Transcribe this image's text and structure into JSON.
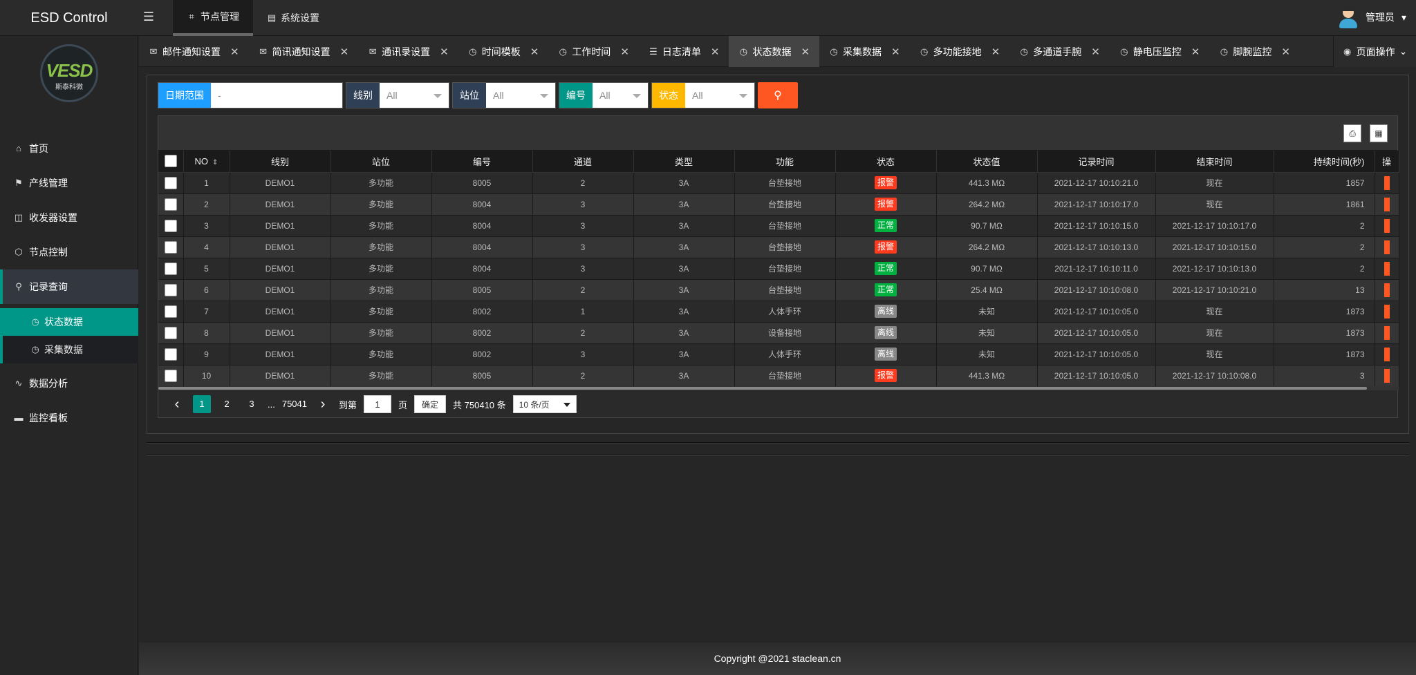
{
  "app": {
    "title": "ESD Control",
    "menu_toggle_icon": "menu-fold-icon"
  },
  "top_nav": [
    {
      "label": "节点管理",
      "icon": "tag-icon",
      "active": true
    },
    {
      "label": "系统设置",
      "icon": "doc-icon",
      "active": false
    }
  ],
  "user": {
    "name": "管理员",
    "caret": "▾"
  },
  "brand": {
    "logo_text": "VESD",
    "company": "斯泰科微"
  },
  "sidebar": {
    "items": [
      {
        "label": "首页",
        "icon": "home-icon"
      },
      {
        "label": "产线管理",
        "icon": "flag-icon"
      },
      {
        "label": "收发器设置",
        "icon": "transceiver-icon"
      },
      {
        "label": "节点控制",
        "icon": "cube-icon"
      },
      {
        "label": "记录查询",
        "icon": "search-icon"
      },
      {
        "label": "数据分析",
        "icon": "pulse-icon"
      },
      {
        "label": "监控看板",
        "icon": "monitor-icon"
      }
    ],
    "sub_items": [
      {
        "label": "状态数据",
        "icon": "clock-icon"
      },
      {
        "label": "采集数据",
        "icon": "clock-icon"
      }
    ]
  },
  "tabs": [
    {
      "label": "邮件通知设置",
      "icon": "mail-icon"
    },
    {
      "label": "简讯通知设置",
      "icon": "sms-icon"
    },
    {
      "label": "通讯录设置",
      "icon": "contacts-icon"
    },
    {
      "label": "时间模板",
      "icon": "clock-icon"
    },
    {
      "label": "工作时间",
      "icon": "clock-icon"
    },
    {
      "label": "日志清单",
      "icon": "list-icon"
    },
    {
      "label": "状态数据",
      "icon": "clock-icon"
    },
    {
      "label": "采集数据",
      "icon": "clock-icon"
    },
    {
      "label": "多功能接地",
      "icon": "clock-icon"
    },
    {
      "label": "多通道手腕",
      "icon": "clock-icon"
    },
    {
      "label": "静电压监控",
      "icon": "clock-icon"
    },
    {
      "label": "脚腕监控",
      "icon": "clock-icon"
    }
  ],
  "page_op": {
    "label": "页面操作",
    "icon": "target-icon"
  },
  "filters": {
    "date": {
      "label": "日期范围",
      "value": "-",
      "color": "#1e9fff"
    },
    "line": {
      "label": "线别",
      "value": "All",
      "color": "#2f4056"
    },
    "station": {
      "label": "站位",
      "value": "All",
      "color": "#2f4056"
    },
    "code": {
      "label": "编号",
      "value": "All",
      "color": "#009688"
    },
    "status": {
      "label": "状态",
      "value": "All",
      "color": "#ffb800"
    },
    "search_icon": "search-icon"
  },
  "table": {
    "headers": [
      "NO",
      "线别",
      "站位",
      "编号",
      "通道",
      "类型",
      "功能",
      "状态",
      "状态值",
      "记录时间",
      "结束时间",
      "持续时间(秒)",
      "操"
    ],
    "rows": [
      [
        "1",
        "DEMO1",
        "多功能",
        "8005",
        "2",
        "3A",
        "台垫接地",
        "报警",
        "441.3 MΩ",
        "2021-12-17 10:10:21.0",
        "现在",
        "1857"
      ],
      [
        "2",
        "DEMO1",
        "多功能",
        "8004",
        "3",
        "3A",
        "台垫接地",
        "报警",
        "264.2 MΩ",
        "2021-12-17 10:10:17.0",
        "现在",
        "1861"
      ],
      [
        "3",
        "DEMO1",
        "多功能",
        "8004",
        "3",
        "3A",
        "台垫接地",
        "正常",
        "90.7 MΩ",
        "2021-12-17 10:10:15.0",
        "2021-12-17 10:10:17.0",
        "2"
      ],
      [
        "4",
        "DEMO1",
        "多功能",
        "8004",
        "3",
        "3A",
        "台垫接地",
        "报警",
        "264.2 MΩ",
        "2021-12-17 10:10:13.0",
        "2021-12-17 10:10:15.0",
        "2"
      ],
      [
        "5",
        "DEMO1",
        "多功能",
        "8004",
        "3",
        "3A",
        "台垫接地",
        "正常",
        "90.7 MΩ",
        "2021-12-17 10:10:11.0",
        "2021-12-17 10:10:13.0",
        "2"
      ],
      [
        "6",
        "DEMO1",
        "多功能",
        "8005",
        "2",
        "3A",
        "台垫接地",
        "正常",
        "25.4 MΩ",
        "2021-12-17 10:10:08.0",
        "2021-12-17 10:10:21.0",
        "13"
      ],
      [
        "7",
        "DEMO1",
        "多功能",
        "8002",
        "1",
        "3A",
        "人体手环",
        "离线",
        "未知",
        "2021-12-17 10:10:05.0",
        "现在",
        "1873"
      ],
      [
        "8",
        "DEMO1",
        "多功能",
        "8002",
        "2",
        "3A",
        "设备接地",
        "离线",
        "未知",
        "2021-12-17 10:10:05.0",
        "现在",
        "1873"
      ],
      [
        "9",
        "DEMO1",
        "多功能",
        "8002",
        "3",
        "3A",
        "人体手环",
        "离线",
        "未知",
        "2021-12-17 10:10:05.0",
        "现在",
        "1873"
      ],
      [
        "10",
        "DEMO1",
        "多功能",
        "8005",
        "2",
        "3A",
        "台垫接地",
        "报警",
        "441.3 MΩ",
        "2021-12-17 10:10:05.0",
        "2021-12-17 10:10:08.0",
        "3"
      ]
    ],
    "status_colors": {
      "报警": "#ff3b1f",
      "正常": "#00b140",
      "离线": "#888888"
    }
  },
  "pager": {
    "prev": "‹",
    "pages": [
      "1",
      "2",
      "3"
    ],
    "ellipsis": "...",
    "last": "75041",
    "next": "›",
    "goto_label": "到第",
    "goto_value": "1",
    "page_unit": "页",
    "confirm": "确定",
    "total": "共 750410 条",
    "per_page": "10 条/页"
  },
  "footer": {
    "copyright": "Copyright @2021 staclean.cn"
  }
}
